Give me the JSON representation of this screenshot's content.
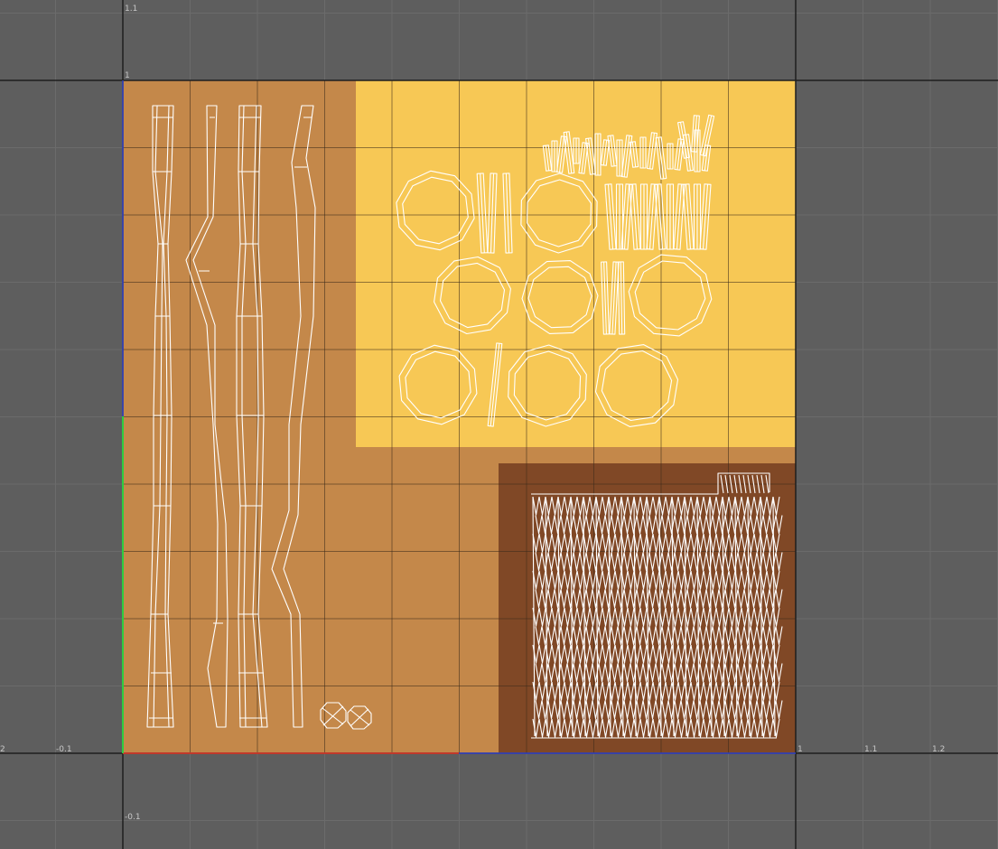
{
  "viewport": {
    "background": "#5e5e5e",
    "grid_minor_color": "#6b6b6b",
    "grid_major_color": "#1f1f1f",
    "axis_u_color": "#c0392b",
    "axis_v_color": "#2ecc40",
    "axis_blue_color": "#3344cc"
  },
  "ticks": {
    "u_1": "1",
    "u_1_1": "1.1",
    "u_1_2": "1.2",
    "u_neg_0_1": "-0.1",
    "u_neg_0_2": "2",
    "v_1": "1",
    "v_1_1": "1.1",
    "v_neg_0_1": "-0.1"
  },
  "texture": {
    "base_color": "#c4884a",
    "yellow_region_color": "#f7c855",
    "dark_region_color": "#804826",
    "overlay_color": "#ffffff"
  }
}
